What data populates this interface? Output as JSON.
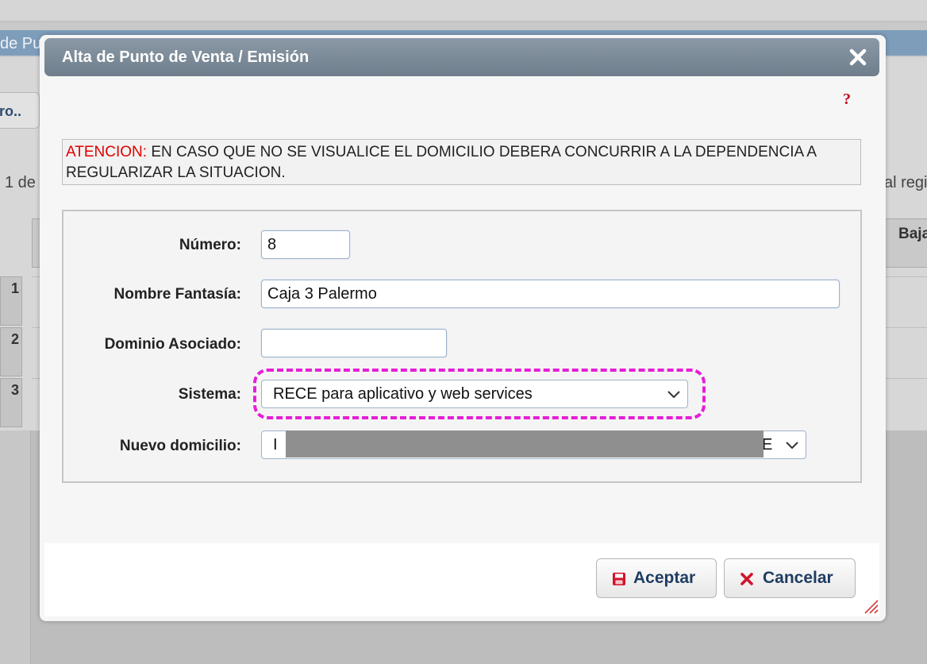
{
  "background": {
    "header_text": "de Pu",
    "button_label": "ro..",
    "pager_text": "1 de",
    "right_text": "al regi",
    "column_header": "Baja",
    "row_numbers": [
      "1",
      "2",
      "3"
    ]
  },
  "dialog": {
    "title": "Alta de Punto de Venta / Emisión",
    "close_icon": "close-icon",
    "help_icon_text": "?",
    "warning": {
      "label": "ATENCION:",
      "text": " EN CASO QUE NO SE VISUALICE EL DOMICILIO DEBERA CONCURRIR A LA DEPENDENCIA A REGULARIZAR LA SITUACION."
    },
    "form": {
      "numero": {
        "label": "Número:",
        "value": "8"
      },
      "nombre_fantasia": {
        "label": "Nombre Fantasía:",
        "value": "Caja 3 Palermo"
      },
      "dominio_asociado": {
        "label": "Dominio Asociado:",
        "value": ""
      },
      "sistema": {
        "label": "Sistema:",
        "value": "RECE para aplicativo y web services"
      },
      "nuevo_domicilio": {
        "label": "Nuevo domicilio:",
        "value_start": "I",
        "value_end": "E"
      }
    },
    "buttons": {
      "aceptar": "Aceptar",
      "cancelar": "Cancelar"
    }
  },
  "colors": {
    "titlebar": "#7a8896",
    "warning_label": "#e00000",
    "highlight": "#e61ed7",
    "button_text": "#1f3d63"
  }
}
